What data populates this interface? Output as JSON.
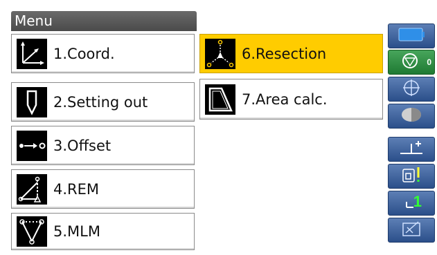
{
  "window": {
    "title": "Menu"
  },
  "menu": {
    "items": [
      {
        "label": "1.Coord.",
        "icon": "coordinate-axes-icon",
        "selected": false
      },
      {
        "label": "2.Setting out",
        "icon": "stake-marker-icon",
        "selected": false
      },
      {
        "label": "3.Offset",
        "icon": "offset-arrow-icon",
        "selected": false
      },
      {
        "label": "4.REM",
        "icon": "remote-elevation-icon",
        "selected": false
      },
      {
        "label": "5.MLM",
        "icon": "missing-line-icon",
        "selected": false
      },
      {
        "label": "6.Resection",
        "icon": "resection-icon",
        "selected": true
      },
      {
        "label": "7.Area calc.",
        "icon": "area-polygon-icon",
        "selected": false
      }
    ]
  },
  "sidebar": {
    "buttons": [
      {
        "icon": "battery-icon",
        "badge": ""
      },
      {
        "icon": "prism-target-icon",
        "badge": "0"
      },
      {
        "icon": "tilt-crosshair-icon",
        "badge": ""
      },
      {
        "icon": "half-circle-icon",
        "badge": ""
      },
      {
        "icon": "instrument-height-icon",
        "badge": ""
      },
      {
        "icon": "laser-pointer-icon",
        "badge": ""
      },
      {
        "icon": "page-one-icon",
        "badge": "1"
      },
      {
        "icon": "input-mode-icon",
        "badge": ""
      }
    ]
  },
  "colors": {
    "selected": "#ffcc00",
    "title_bar": "#555555",
    "side_button": "#3b5f9a",
    "side_button_green": "#2f8f45"
  }
}
